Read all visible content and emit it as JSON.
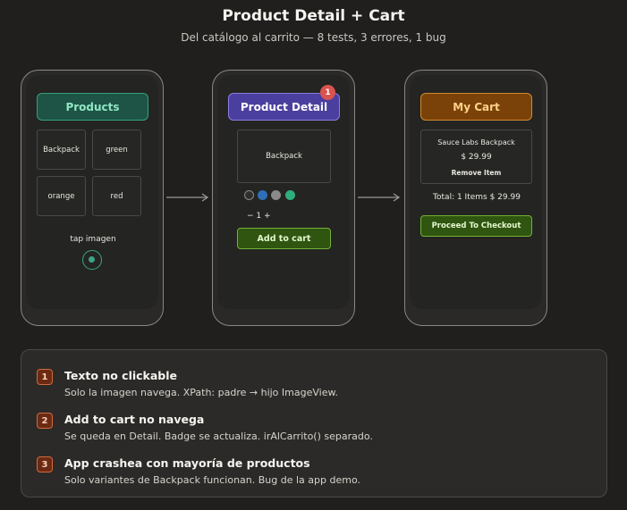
{
  "title": "Product Detail + Cart",
  "subtitle": "Del catálogo al carrito — 8 tests, 3 errores, 1 bug",
  "screens": {
    "products": {
      "header": "Products",
      "tiles": [
        "Backpack",
        "green",
        "orange",
        "red"
      ],
      "tap_label": "tap imagen"
    },
    "detail": {
      "header": "Product Detail",
      "badge": "1",
      "image_label": "Backpack",
      "swatch_colors": [
        "#2f2f2f",
        "#2f6fb7",
        "#8a8a8a",
        "#2fae7d"
      ],
      "quantity": "− 1 +",
      "add_button": "Add to cart"
    },
    "cart": {
      "header": "My Cart",
      "item_name": "Sauce Labs Backpack",
      "item_price": "$ 29.99",
      "remove_label": "Remove Item",
      "total": "Total: 1 Items  $ 29.99",
      "checkout_button": "Proceed To Checkout"
    }
  },
  "notes": [
    {
      "num": "1",
      "title": "Texto no clickable",
      "desc": "Solo la imagen navega. XPath: padre → hijo ImageView."
    },
    {
      "num": "2",
      "title": "Add to cart no navega",
      "desc": "Se queda en Detail. Badge se actualiza. irAlCarrito() separado."
    },
    {
      "num": "3",
      "title": "App crashea con mayoría de productos",
      "desc": "Solo variantes de Backpack funcionan. Bug de la app demo."
    }
  ]
}
